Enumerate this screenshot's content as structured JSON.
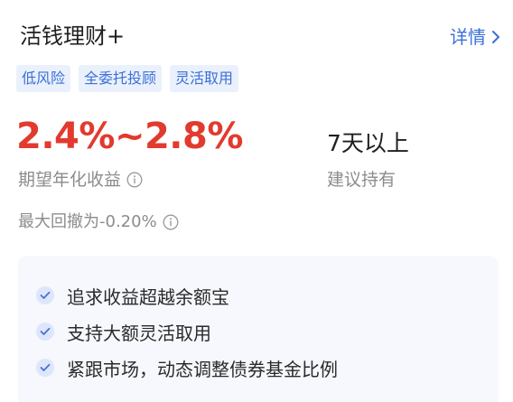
{
  "header": {
    "title": "活钱理财+",
    "detail_label": "详情"
  },
  "tags": [
    "低风险",
    "全委托投顾",
    "灵活取用"
  ],
  "metrics": {
    "rate_value": "2.4%~2.8%",
    "rate_label": "期望年化收益",
    "hold_value": "7天以上",
    "hold_label": "建议持有",
    "drawdown": "最大回撤为-0.20%"
  },
  "features": [
    "追求收益超越余额宝",
    "支持大额灵活取用",
    "紧跟市场，动态调整债券基金比例"
  ],
  "colors": {
    "accent": "#3b6fd9",
    "rate": "#e23a2e",
    "tag_bg": "#eaf1fd",
    "features_bg": "#f6f8fd"
  },
  "icons": {
    "info": "info-circle-icon",
    "check": "check-icon",
    "chevron": "chevron-right-icon"
  }
}
